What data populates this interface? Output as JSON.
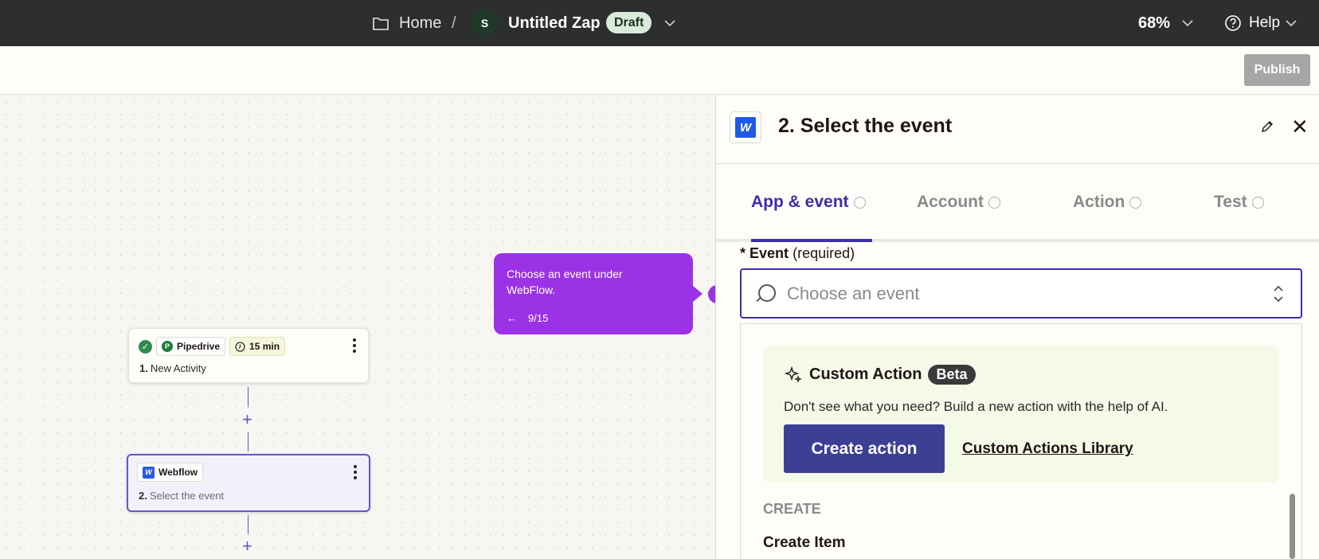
{
  "topbar": {
    "home": "Home",
    "separator": "/",
    "avatar_initial": "S",
    "zap_name": "Untitled Zap",
    "status": "Draft",
    "zoom": "68%",
    "help": "Help"
  },
  "subbar": {
    "publish": "Publish"
  },
  "canvas": {
    "node1": {
      "app": "Pipedrive",
      "app_initial": "P",
      "interval": "15 min",
      "step": "1.",
      "title": "New Activity"
    },
    "node2": {
      "app": "Webflow",
      "app_initial": "W",
      "step": "2.",
      "title": "Select the event"
    },
    "plus": "+"
  },
  "tooltip": {
    "text": "Choose an event under WebFlow.",
    "back_arrow": "←",
    "progress": "9/15"
  },
  "panel": {
    "logo_initial": "W",
    "title": "2. Select the event",
    "close": "✕",
    "tabs": [
      {
        "label": "App & event"
      },
      {
        "label": "Account"
      },
      {
        "label": "Action"
      },
      {
        "label": "Test"
      }
    ],
    "field": {
      "required_mark": "*",
      "label": "Event",
      "hint": "(required)",
      "placeholder": "Choose an event"
    },
    "custom_action": {
      "title": "Custom Action",
      "badge": "Beta",
      "description": "Don't see what you need? Build a new action with the help of AI.",
      "button": "Create action",
      "link": "Custom Actions Library"
    },
    "group_header": "CREATE",
    "items": [
      "Create Item"
    ]
  },
  "colors": {
    "accent": "#3b2fa8",
    "tooltip": "#9b32e6",
    "topbar": "#2d2e2e",
    "button": "#3d3f95"
  }
}
